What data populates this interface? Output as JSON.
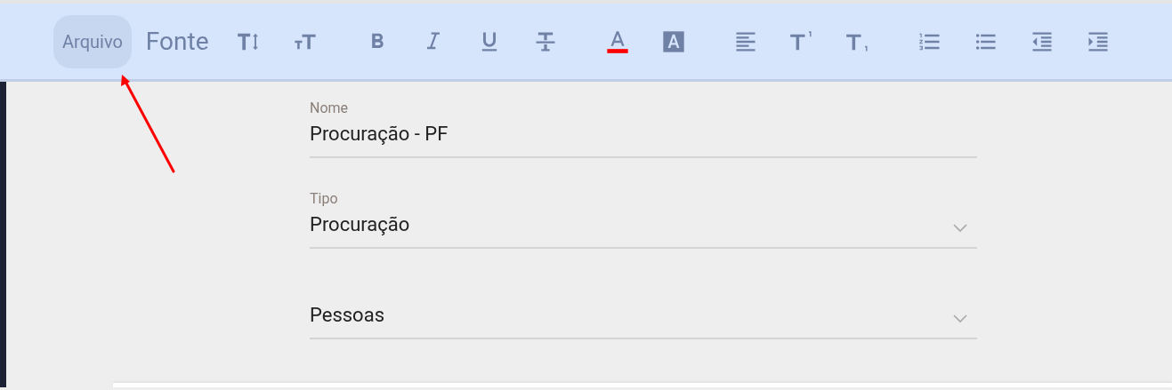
{
  "toolbar": {
    "menus": [
      {
        "label": "Arquivo",
        "selected": true
      },
      {
        "label": "Fonte",
        "selected": false
      }
    ],
    "groups": [
      [
        {
          "kind": "text-size"
        },
        {
          "kind": "small-caps"
        }
      ],
      [
        {
          "kind": "bold"
        },
        {
          "kind": "italic"
        },
        {
          "kind": "underline"
        },
        {
          "kind": "strikethrough"
        }
      ],
      [
        {
          "kind": "text-color"
        },
        {
          "kind": "highlight"
        }
      ],
      [
        {
          "kind": "align-left"
        },
        {
          "kind": "superscript"
        },
        {
          "kind": "subscript"
        }
      ],
      [
        {
          "kind": "numbered-list"
        },
        {
          "kind": "bulleted-list"
        },
        {
          "kind": "outdent"
        },
        {
          "kind": "indent"
        }
      ]
    ]
  },
  "fields": [
    {
      "kind": "text",
      "label": "Nome",
      "value": "Procuração - PF"
    },
    {
      "kind": "select",
      "label": "Tipo",
      "value": "Procuração"
    },
    {
      "kind": "select",
      "value": "Pessoas"
    }
  ]
}
